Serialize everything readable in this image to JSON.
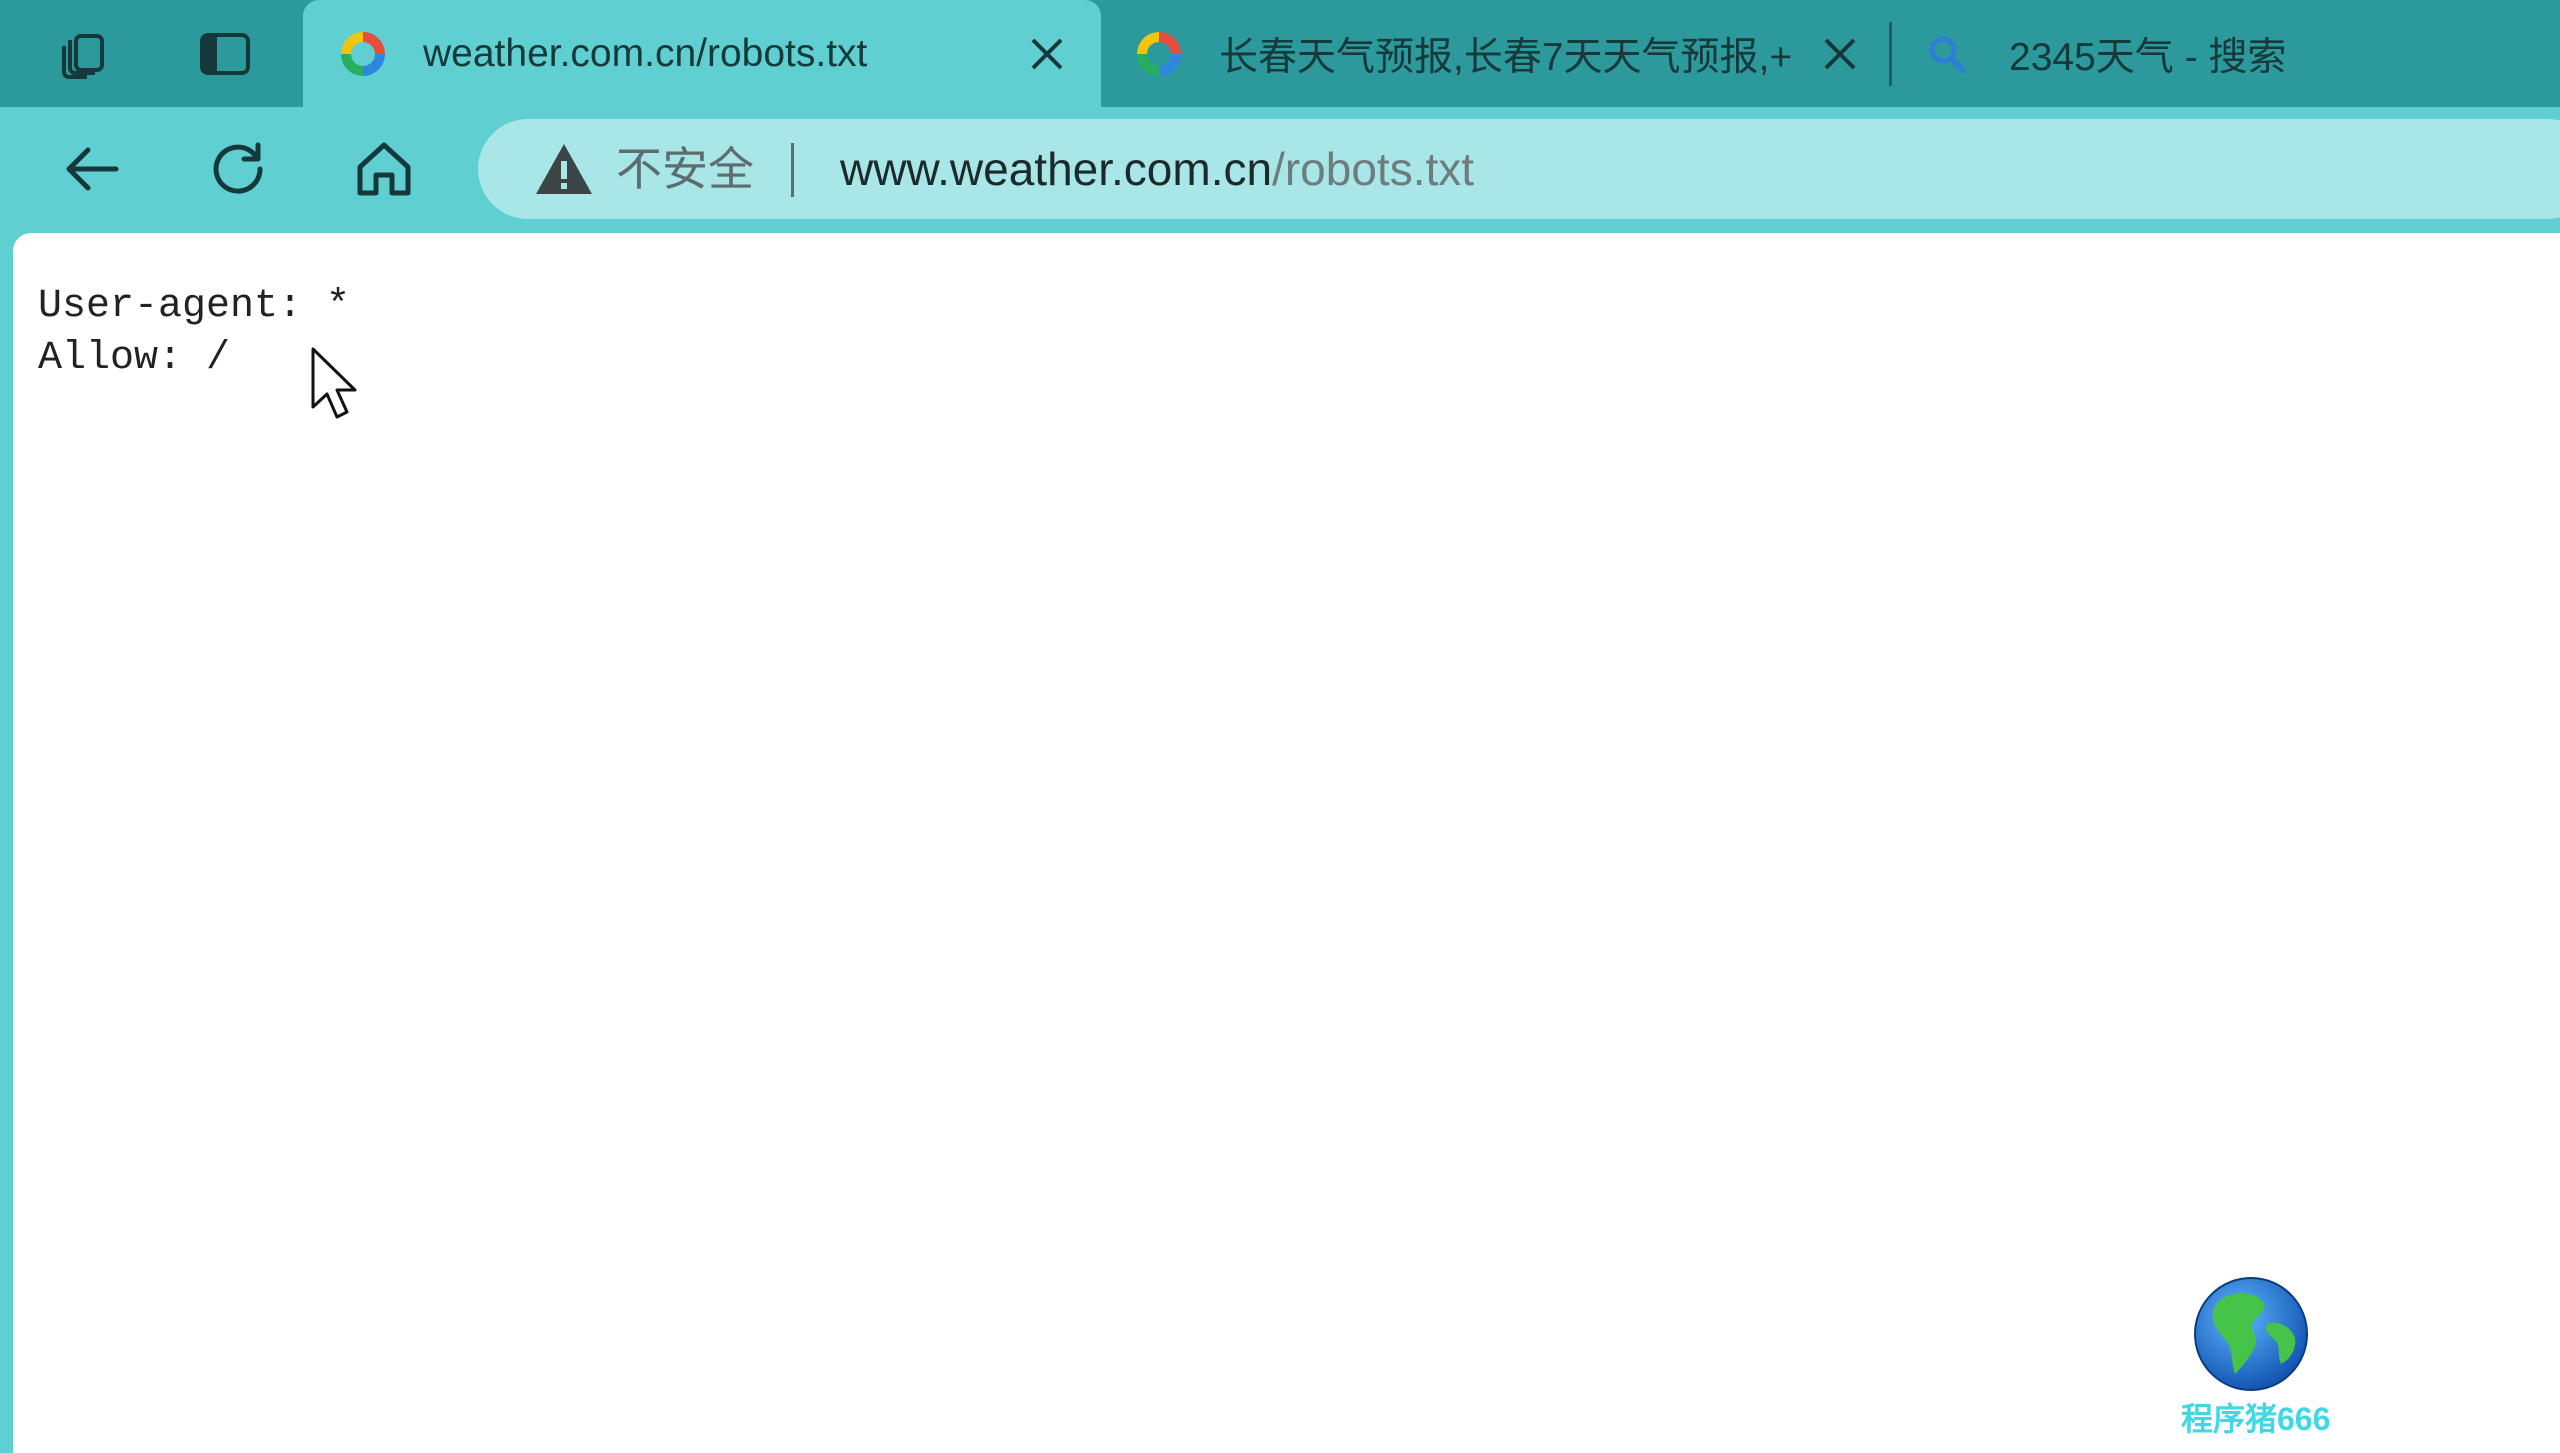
{
  "tabs": [
    {
      "title": "weather.com.cn/robots.txt",
      "active": true,
      "favicon": "browser-favicon-icon"
    },
    {
      "title": "长春天气预报,长春7天天气预报,+",
      "active": false,
      "favicon": "browser-favicon-icon"
    },
    {
      "title": "2345天气 - 搜索",
      "active": false,
      "favicon": "search-icon"
    }
  ],
  "toolbar": {
    "security_label": "不安全",
    "url_host": "www.weather.com.cn",
    "url_path": "/robots.txt"
  },
  "page": {
    "text": "User-agent: *\nAllow: /"
  },
  "watermark": {
    "label": "程序猪666"
  },
  "colors": {
    "tabbar": "#2c9a9c",
    "accent": "#5fcfd2",
    "omnibox": "#a9e6e7",
    "watermark_text": "#3fd8e4"
  }
}
